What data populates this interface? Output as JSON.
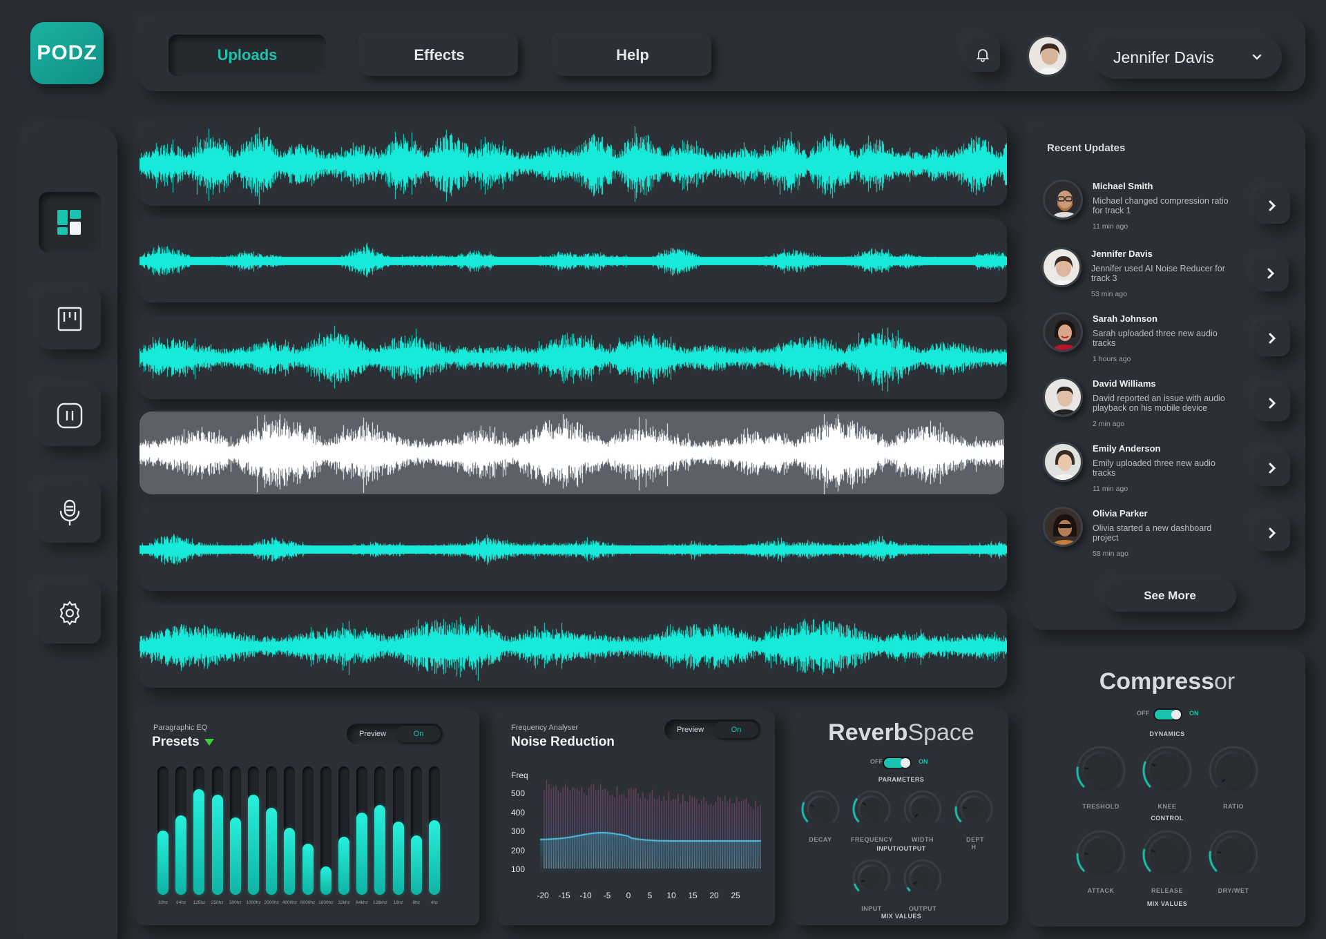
{
  "brand": {
    "logo_text": "PODZ",
    "accent": "#19c3b0",
    "wave_color": "#17ead8"
  },
  "nav": {
    "tabs": [
      {
        "label": "Uploads",
        "active": true
      },
      {
        "label": "Effects"
      },
      {
        "label": "Help"
      }
    ]
  },
  "user": {
    "name": "Jennifer Davis"
  },
  "sidebar": {
    "items": [
      "dashboard-icon",
      "board-icon",
      "pause-icon",
      "microphone-icon",
      "settings-icon"
    ]
  },
  "tracks": [
    {
      "selected": false
    },
    {
      "selected": false
    },
    {
      "selected": false
    },
    {
      "selected": true
    },
    {
      "selected": false
    },
    {
      "selected": false
    }
  ],
  "updates": {
    "title": "Recent Updates",
    "items": [
      {
        "name": "Michael Smith",
        "text": "Michael changed compression ratio for track 1",
        "time": "11 min ago"
      },
      {
        "name": "Jennifer Davis",
        "text": "Jennifer used AI Noise Reducer for track 3",
        "time": "53 min ago"
      },
      {
        "name": "Sarah Johnson",
        "text": "Sarah uploaded three new audio tracks",
        "time": "1 hours ago"
      },
      {
        "name": "David Williams",
        "text": "David reported an issue with audio playback on his mobile device",
        "time": "2 min ago"
      },
      {
        "name": "Emily Anderson",
        "text": "Emily uploaded three new audio tracks",
        "time": "11 min ago"
      },
      {
        "name": "Olivia Parker",
        "text": "Olivia started a new dashboard project",
        "time": "58 min ago"
      }
    ],
    "see_more": "See More"
  },
  "eq": {
    "subtitle": "Paragraphic EQ",
    "title": "Presets",
    "preview": "Preview",
    "on": "On",
    "bands": [
      "32hz",
      "64hz",
      "125hz",
      "250hz",
      "500hz",
      "1000hz",
      "2000hz",
      "4000hz",
      "8000hz",
      "1600hz",
      "32khz",
      "64khz",
      "128khz",
      "16hz",
      "8hz",
      "4hz"
    ],
    "levels": [
      0.5,
      0.62,
      0.82,
      0.78,
      0.6,
      0.78,
      0.68,
      0.52,
      0.4,
      0.22,
      0.45,
      0.64,
      0.7,
      0.57,
      0.46,
      0.58
    ]
  },
  "analyser": {
    "subtitle": "Frequency Analyser",
    "title": "Noise Reduction",
    "preview": "Preview",
    "on": "On",
    "y_title": "Freq",
    "y_ticks": [
      "500",
      "400",
      "300",
      "200",
      "100"
    ],
    "x_ticks": [
      "-20",
      "-15",
      "-10",
      "-5",
      "0",
      "5",
      "10",
      "15",
      "20",
      "25"
    ]
  },
  "reverb": {
    "title_bold": "Reverb",
    "title_light": "Space",
    "off": "OFF",
    "on": "ON",
    "params_label": "PARAMETERS",
    "params": [
      {
        "label": "DECAY",
        "value": 0.25
      },
      {
        "label": "FREQUENCY",
        "value": 0.3
      },
      {
        "label": "WIDTH",
        "value": 0.0
      },
      {
        "label": "DEPT H",
        "value": 0.2
      }
    ],
    "io_label": "INPUT/OUTPUT",
    "io": [
      {
        "label": "INPUT",
        "value": 0.1
      },
      {
        "label": "OUTPUT",
        "value": 0.05
      }
    ],
    "footer": "MIX VALUES"
  },
  "compressor": {
    "title_bold": "Compress",
    "title_light": "or",
    "off": "OFF",
    "on": "ON",
    "dynamics_label": "DYNAMICS",
    "dynamics": [
      {
        "label": "TRESHOLD",
        "value": 0.2
      },
      {
        "label": "KNEE",
        "value": 0.25
      },
      {
        "label": "RATIO",
        "value": 0.0
      }
    ],
    "control_label": "CONTROL",
    "control": [
      {
        "label": "ATTACK",
        "value": 0.18
      },
      {
        "label": "RELEASE",
        "value": 0.22
      },
      {
        "label": "DRY/WET",
        "value": 0.2
      }
    ],
    "footer": "MIX VALUES"
  }
}
